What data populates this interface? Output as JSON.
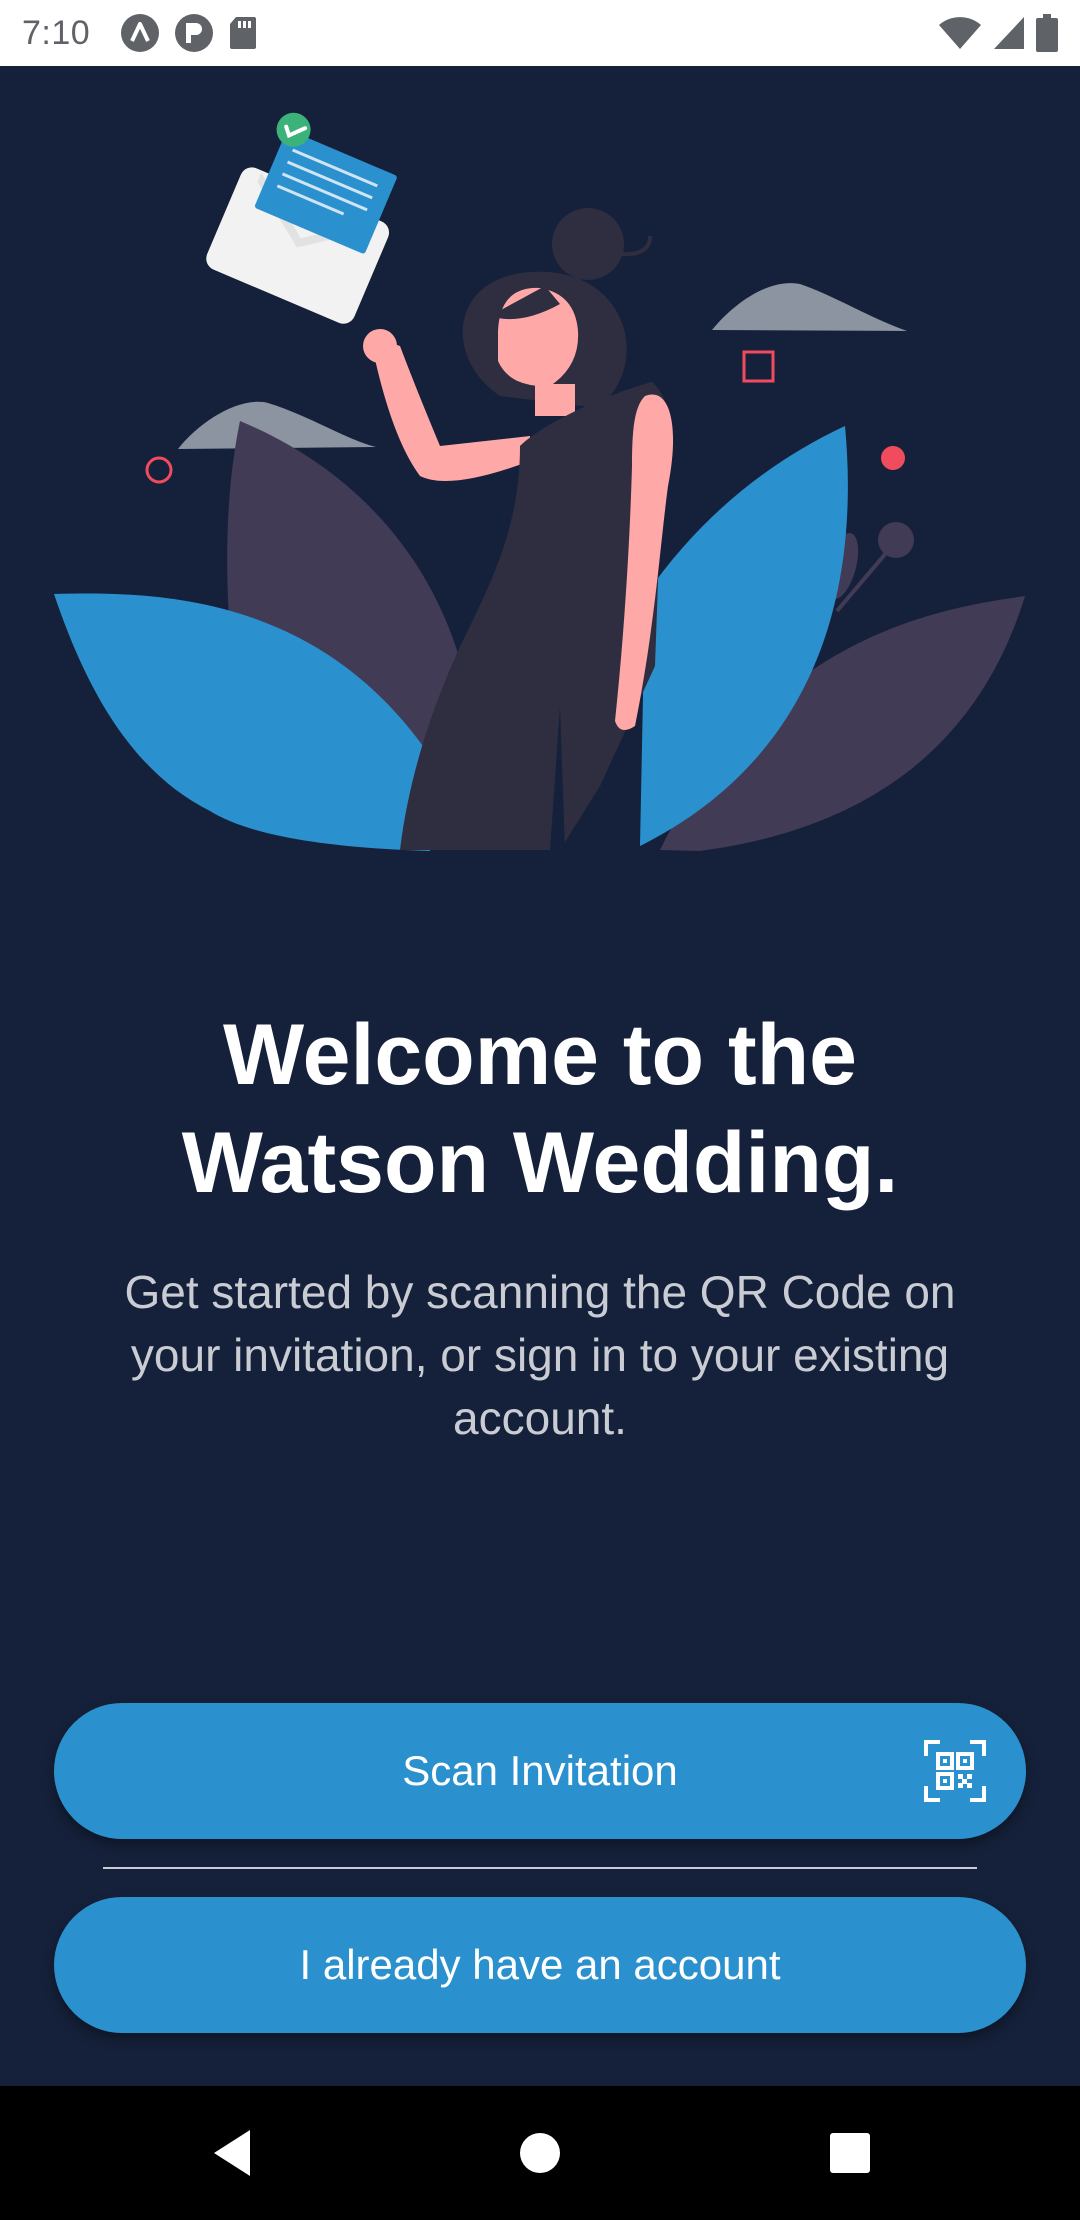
{
  "status_bar": {
    "time": "7:10",
    "left_icons": [
      "notification-a-icon",
      "notification-p-icon",
      "sd-card-icon"
    ],
    "right_icons": [
      "wifi-icon",
      "signal-icon",
      "battery-icon"
    ]
  },
  "welcome": {
    "title_line1": "Welcome to the",
    "title_line2": "Watson Wedding.",
    "subtitle": "Get started by scanning the QR Code on your invitation, or sign in to your existing account."
  },
  "actions": {
    "scan_label": "Scan Invitation",
    "scan_icon": "qr-code-icon",
    "account_label": "I already have an account"
  },
  "nav_bar": {
    "icons": [
      "back-icon",
      "home-icon",
      "recents-icon"
    ]
  },
  "colors": {
    "background": "#15213a",
    "accent": "#2b91ce",
    "dark_leaf": "#413b55",
    "skin": "#ffa8a8",
    "dress": "#2f2e41",
    "red_dot": "#f14b5e",
    "check": "#3ab27a"
  }
}
